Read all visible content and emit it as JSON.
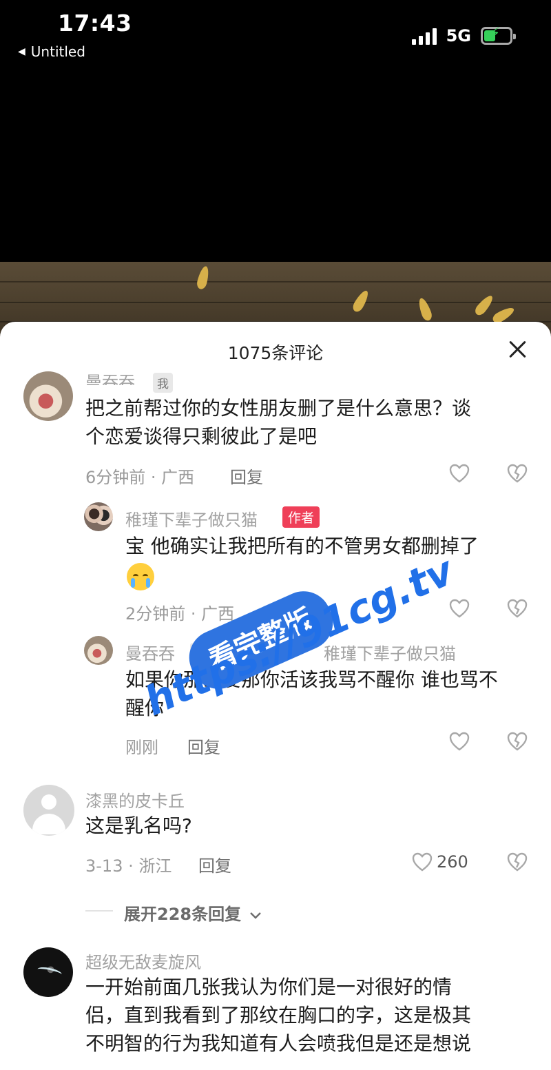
{
  "status_bar": {
    "time": "17:43",
    "back_label": "Untitled",
    "network": "5G",
    "battery_color": "#36d15a"
  },
  "sheet": {
    "title": "1075条评论"
  },
  "comments": [
    {
      "username": "曼吞吞",
      "tag": "我",
      "text_line1": "把之前帮过你的女性朋友删了是什么意思？谈",
      "text_line2": "个恋爱谈得只剩彼此了是吧",
      "meta": "6分钟前 · 广西",
      "reply_label": "回复"
    },
    {
      "username": "稚瑾下辈子做只猫",
      "tag": "作者",
      "text": "宝 他确实让我把所有的不管男女都删掉了",
      "meta": "2分钟前 · 广西",
      "reply_label": "回复"
    },
    {
      "username": "曼吞吞",
      "tag": "我",
      "reply_to": "稚瑾下辈子做只猫",
      "text_line1": "如果你那么爱那你活该我骂不醒你 谁也骂不",
      "text_line2": "醒你",
      "meta": "刚刚",
      "reply_label": "回复"
    },
    {
      "username": "漆黑的皮卡丘",
      "text": "这是乳名吗?",
      "meta": "3-13 · 浙江",
      "reply_label": "回复",
      "likes": "260",
      "expand_label": "展开228条回复"
    },
    {
      "username": "超级无敌麦旋风",
      "text_line1": "一开始前面几张我认为你们是一对很好的情",
      "text_line2": "侣，直到我看到了那纹在胸口的字，这是极其",
      "text_line3": "不明智的行为我知道有人会喷我但是还是想说"
    }
  ],
  "watermark": {
    "badge": "看完整版",
    "url": "https://91cg.tv"
  },
  "icons": [
    "heart-icon",
    "dislike-icon",
    "close-icon",
    "chevron-down-icon",
    "signal-icon",
    "battery-icon"
  ]
}
